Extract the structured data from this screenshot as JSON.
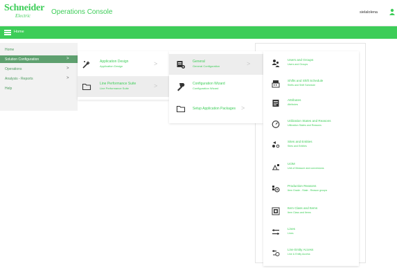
{
  "header": {
    "logo_line1": "Schneider",
    "logo_line2": "Electric",
    "app_title": "Operations Console",
    "user_name": "sielalolena"
  },
  "navbar": {
    "home_label": "Home"
  },
  "col1": {
    "items": [
      {
        "label": "Home",
        "chevron": ""
      },
      {
        "label": "Solution Configuration",
        "chevron": ">"
      },
      {
        "label": "Operations",
        "chevron": ">"
      },
      {
        "label": "Analysis - Reports",
        "chevron": ">"
      },
      {
        "label": "Help",
        "chevron": ""
      }
    ]
  },
  "col2": {
    "items": [
      {
        "title": "Application Design",
        "subtitle": "Application Design",
        "chevron": ">",
        "icon": "wand-icon"
      },
      {
        "title": "Line Performance Suite",
        "subtitle": "Line Performance Suite",
        "chevron": ">",
        "icon": "folder-icon"
      }
    ]
  },
  "col3": {
    "items": [
      {
        "title": "General",
        "subtitle": "General Configuration",
        "chevron": ">",
        "icon": "general-config-icon"
      },
      {
        "title": "Configuration Wizard",
        "subtitle": "Configuration Wizard",
        "icon": "wizard-icon"
      },
      {
        "title": "Setup Application Packages",
        "chevron": ">",
        "icon": "folder-icon"
      }
    ]
  },
  "col4": {
    "items": [
      {
        "title": "Users and Groups",
        "subtitle": "Users and Groups",
        "icon": "users-icon"
      },
      {
        "title": "Shifts and Shift Schedule",
        "subtitle": "Shifts and Shift Schedule",
        "icon": "shift-icon"
      },
      {
        "title": "Attributes",
        "subtitle": "Attributes",
        "icon": "attributes-icon"
      },
      {
        "title": "Utilization States and Reasons",
        "subtitle": "Utilization States and Reasons",
        "icon": "gauge-icon"
      },
      {
        "title": "Sites and Entities",
        "subtitle": "Sites and Entities",
        "icon": "sites-icon"
      },
      {
        "title": "UOM",
        "subtitle": "Unit of Measure and conversions",
        "icon": "uom-icon"
      },
      {
        "title": "Production Reasons",
        "subtitle": "Item Grade - State - Reason groups",
        "icon": "production-reasons-icon"
      },
      {
        "title": "Item Class and Items",
        "subtitle": "Item Class and Items",
        "icon": "item-class-icon"
      },
      {
        "title": "Lines",
        "subtitle": "Lines",
        "icon": "lines-icon"
      },
      {
        "title": "Line Entity Access",
        "subtitle": "Line & Entity Access",
        "icon": "line-entity-icon"
      }
    ]
  }
}
